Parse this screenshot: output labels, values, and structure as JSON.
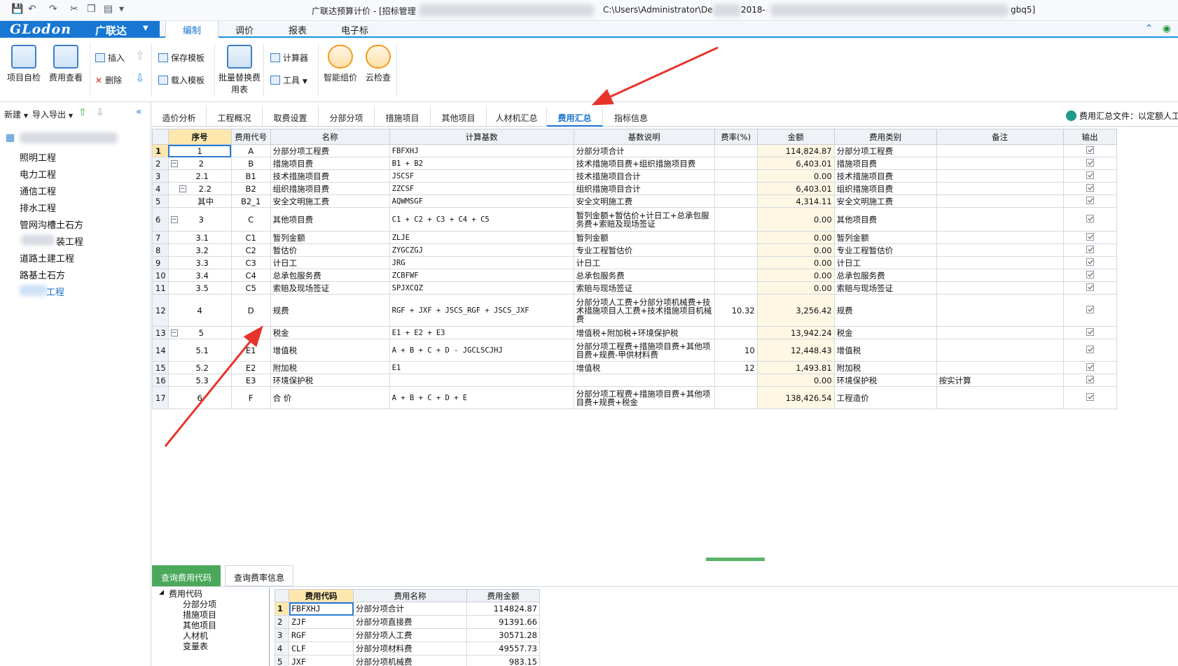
{
  "window": {
    "title": "广联达预算计价 - [招标管理",
    "path": "C:\\Users\\Administrator\\De",
    "path_tail": "2018-",
    "title_tail": "gbq5]"
  },
  "logo": {
    "brand": "GLodon",
    "brand_cn": "广联达"
  },
  "menu": {
    "tabs": [
      "编制",
      "调价",
      "报表",
      "电子标"
    ]
  },
  "ribbon": {
    "self_check": "项目自检",
    "fee_view": "费用查看",
    "insert": "插入",
    "delete": "删除",
    "save_template": "保存模板",
    "load_template": "载入模板",
    "batch_replace": "批量替换费用表",
    "calculator": "计算器",
    "tools": "工具",
    "smart_price": "智能组价",
    "cloud_check": "云检查"
  },
  "left_panel": {
    "new": "新建",
    "import_export": "导入导出",
    "items": [
      "照明工程",
      "电力工程",
      "通信工程",
      "排水工程",
      "管网沟槽土石方",
      "装工程",
      "道路土建工程",
      "路基土石方",
      "工程"
    ]
  },
  "tabs": [
    "造价分析",
    "工程概况",
    "取费设置",
    "分部分项",
    "措施项目",
    "其他项目",
    "人材机汇总",
    "费用汇总",
    "指标信息"
  ],
  "fee_file_label": "费用汇总文件：以定额人工",
  "table": {
    "headers": [
      "序号",
      "费用代号",
      "名称",
      "计算基数",
      "基数说明",
      "费率(%)",
      "金额",
      "费用类别",
      "备注",
      "输出"
    ],
    "rows": [
      {
        "n": "1",
        "seq": "1",
        "code": "A",
        "name": "分部分项工程费",
        "base": "FBFXHJ",
        "desc": "分部分项合计",
        "rate": "",
        "amount": "114,824.87",
        "cat": "分部分项工程费",
        "note": ""
      },
      {
        "n": "2",
        "seq": "2",
        "code": "B",
        "name": "措施项目费",
        "base": "B1 + B2",
        "desc": "技术措施项目费+组织措施项目费",
        "rate": "",
        "amount": "6,403.01",
        "cat": "措施项目费",
        "note": ""
      },
      {
        "n": "3",
        "seq": "2.1",
        "code": "B1",
        "name": "技术措施项目费",
        "base": "JSCSF",
        "desc": "技术措施项目合计",
        "rate": "",
        "amount": "0.00",
        "cat": "技术措施项目费",
        "note": ""
      },
      {
        "n": "4",
        "seq": "2.2",
        "code": "B2",
        "name": "组织措施项目费",
        "base": "ZZCSF",
        "desc": "组织措施项目合计",
        "rate": "",
        "amount": "6,403.01",
        "cat": "组织措施项目费",
        "note": ""
      },
      {
        "n": "5",
        "seq": "其中",
        "code": "B2_1",
        "name": "安全文明施工费",
        "base": "AQWMSGF",
        "desc": "安全文明施工费",
        "rate": "",
        "amount": "4,314.11",
        "cat": "安全文明施工费",
        "note": ""
      },
      {
        "n": "6",
        "seq": "3",
        "code": "C",
        "name": "其他项目费",
        "base": "C1 + C2 + C3 + C4 + C5",
        "desc": "暂列金额+暂估价+计日工+总承包服务费+索赔及现场签证",
        "rate": "",
        "amount": "0.00",
        "cat": "其他项目费",
        "note": ""
      },
      {
        "n": "7",
        "seq": "3.1",
        "code": "C1",
        "name": "暂列金额",
        "base": "ZLJE",
        "desc": "暂列金额",
        "rate": "",
        "amount": "0.00",
        "cat": "暂列金额",
        "note": ""
      },
      {
        "n": "8",
        "seq": "3.2",
        "code": "C2",
        "name": "暂估价",
        "base": "ZYGCZGJ",
        "desc": "专业工程暂估价",
        "rate": "",
        "amount": "0.00",
        "cat": "专业工程暂估价",
        "note": ""
      },
      {
        "n": "9",
        "seq": "3.3",
        "code": "C3",
        "name": "计日工",
        "base": "JRG",
        "desc": "计日工",
        "rate": "",
        "amount": "0.00",
        "cat": "计日工",
        "note": ""
      },
      {
        "n": "10",
        "seq": "3.4",
        "code": "C4",
        "name": "总承包服务费",
        "base": "ZCBFWF",
        "desc": "总承包服务费",
        "rate": "",
        "amount": "0.00",
        "cat": "总承包服务费",
        "note": ""
      },
      {
        "n": "11",
        "seq": "3.5",
        "code": "C5",
        "name": "索赔及现场签证",
        "base": "SPJXCQZ",
        "desc": "索赔与现场签证",
        "rate": "",
        "amount": "0.00",
        "cat": "索赔与现场签证",
        "note": ""
      },
      {
        "n": "12",
        "seq": "4",
        "code": "D",
        "name": "规费",
        "base": "RGF + JXF + JSCS_RGF + JSCS_JXF",
        "desc": "分部分项人工费+分部分项机械费+技术措施项目人工费+技术措施项目机械费",
        "rate": "10.32",
        "amount": "3,256.42",
        "cat": "规费",
        "note": ""
      },
      {
        "n": "13",
        "seq": "5",
        "code": "",
        "name": "税金",
        "base": "E1 + E2 + E3",
        "desc": "增值税+附加税+环境保护税",
        "rate": "",
        "amount": "13,942.24",
        "cat": "税金",
        "note": ""
      },
      {
        "n": "14",
        "seq": "5.1",
        "code": "E1",
        "name": "增值税",
        "base": "A + B + C + D - JGCLSCJHJ",
        "desc": "分部分项工程费+措施项目费+其他项目费+规费-甲供材料费",
        "rate": "10",
        "amount": "12,448.43",
        "cat": "增值税",
        "note": ""
      },
      {
        "n": "15",
        "seq": "5.2",
        "code": "E2",
        "name": "附加税",
        "base": "E1",
        "desc": "增值税",
        "rate": "12",
        "amount": "1,493.81",
        "cat": "附加税",
        "note": ""
      },
      {
        "n": "16",
        "seq": "5.3",
        "code": "E3",
        "name": "环境保护税",
        "base": "",
        "desc": "",
        "rate": "",
        "amount": "0.00",
        "cat": "环境保护税",
        "note": "按实计算"
      },
      {
        "n": "17",
        "seq": "6",
        "code": "F",
        "name": "合  价",
        "base": "A + B + C + D + E",
        "desc": "分部分项工程费+措施项目费+其他项目费+规费+税金",
        "rate": "",
        "amount": "138,426.54",
        "cat": "工程造价",
        "note": ""
      }
    ]
  },
  "bottom": {
    "tabs": [
      "查询费用代码",
      "查询费率信息"
    ],
    "tree_root": "费用代码",
    "tree_items": [
      "分部分项",
      "措施项目",
      "其他项目",
      "人材机",
      "变量表"
    ],
    "headers": [
      "费用代码",
      "费用名称",
      "费用金额"
    ],
    "rows": [
      {
        "n": "1",
        "code": "FBFXHJ",
        "name": "分部分项合计",
        "amount": "114824.87"
      },
      {
        "n": "2",
        "code": "ZJF",
        "name": "分部分项直接费",
        "amount": "91391.66"
      },
      {
        "n": "3",
        "code": "RGF",
        "name": "分部分项人工费",
        "amount": "30571.28"
      },
      {
        "n": "4",
        "code": "CLF",
        "name": "分部分项材料费",
        "amount": "49557.73"
      },
      {
        "n": "5",
        "code": "JXF",
        "name": "分部分项机械费",
        "amount": "983.15"
      }
    ]
  },
  "colors": {
    "accent": "#1a73d0",
    "brand": "#1777d2",
    "header_highlight": "#fde7ad",
    "active_bottom_tab": "#4aa85a",
    "annotation": "#e8332a"
  }
}
